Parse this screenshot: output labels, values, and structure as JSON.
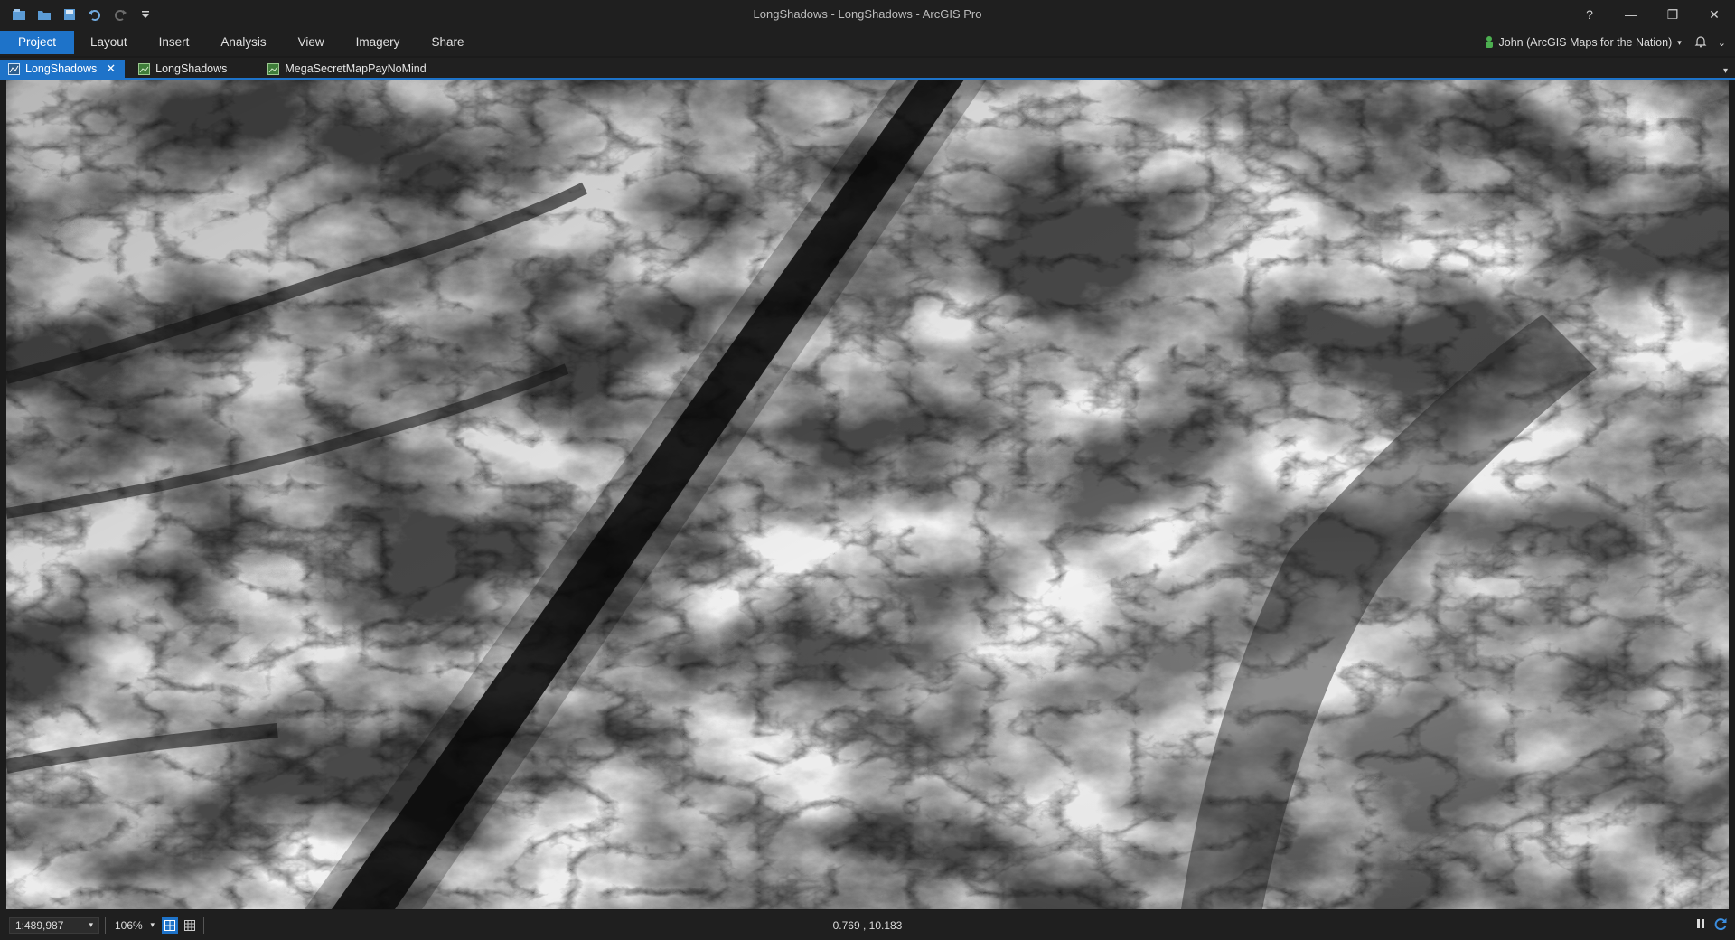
{
  "window": {
    "title": "LongShadows - LongShadows - ArcGIS Pro",
    "controls": {
      "help": "?",
      "minimize": "—",
      "restore": "❐",
      "close": "✕"
    }
  },
  "quick_access": [
    "project-icon",
    "open-icon",
    "save-icon",
    "undo-icon",
    "redo-icon",
    "customize-icon"
  ],
  "ribbon": {
    "tabs": [
      "Project",
      "Layout",
      "Insert",
      "Analysis",
      "View",
      "Imagery",
      "Share"
    ],
    "active_tab": "Project"
  },
  "user": {
    "label": "John (ArcGIS Maps for the Nation)",
    "status_color": "#4caf50"
  },
  "view_tabs": [
    {
      "label": "LongShadows",
      "active": true,
      "icon": "map-view-icon"
    },
    {
      "label": "LongShadows",
      "active": false,
      "icon": "map-icon"
    },
    {
      "label": "MegaSecretMapPayNoMind",
      "active": false,
      "icon": "map-icon"
    }
  ],
  "map": {
    "content": "grayscale elevation raster (DEM)",
    "colors": {
      "low": "#000000",
      "high": "#ffffff"
    }
  },
  "status": {
    "scale": "1:489,987",
    "zoom": "106%",
    "coordinates": "0.769 , 10.183"
  },
  "colors": {
    "accent": "#1e73c9",
    "chrome": "#1f1f1f"
  }
}
